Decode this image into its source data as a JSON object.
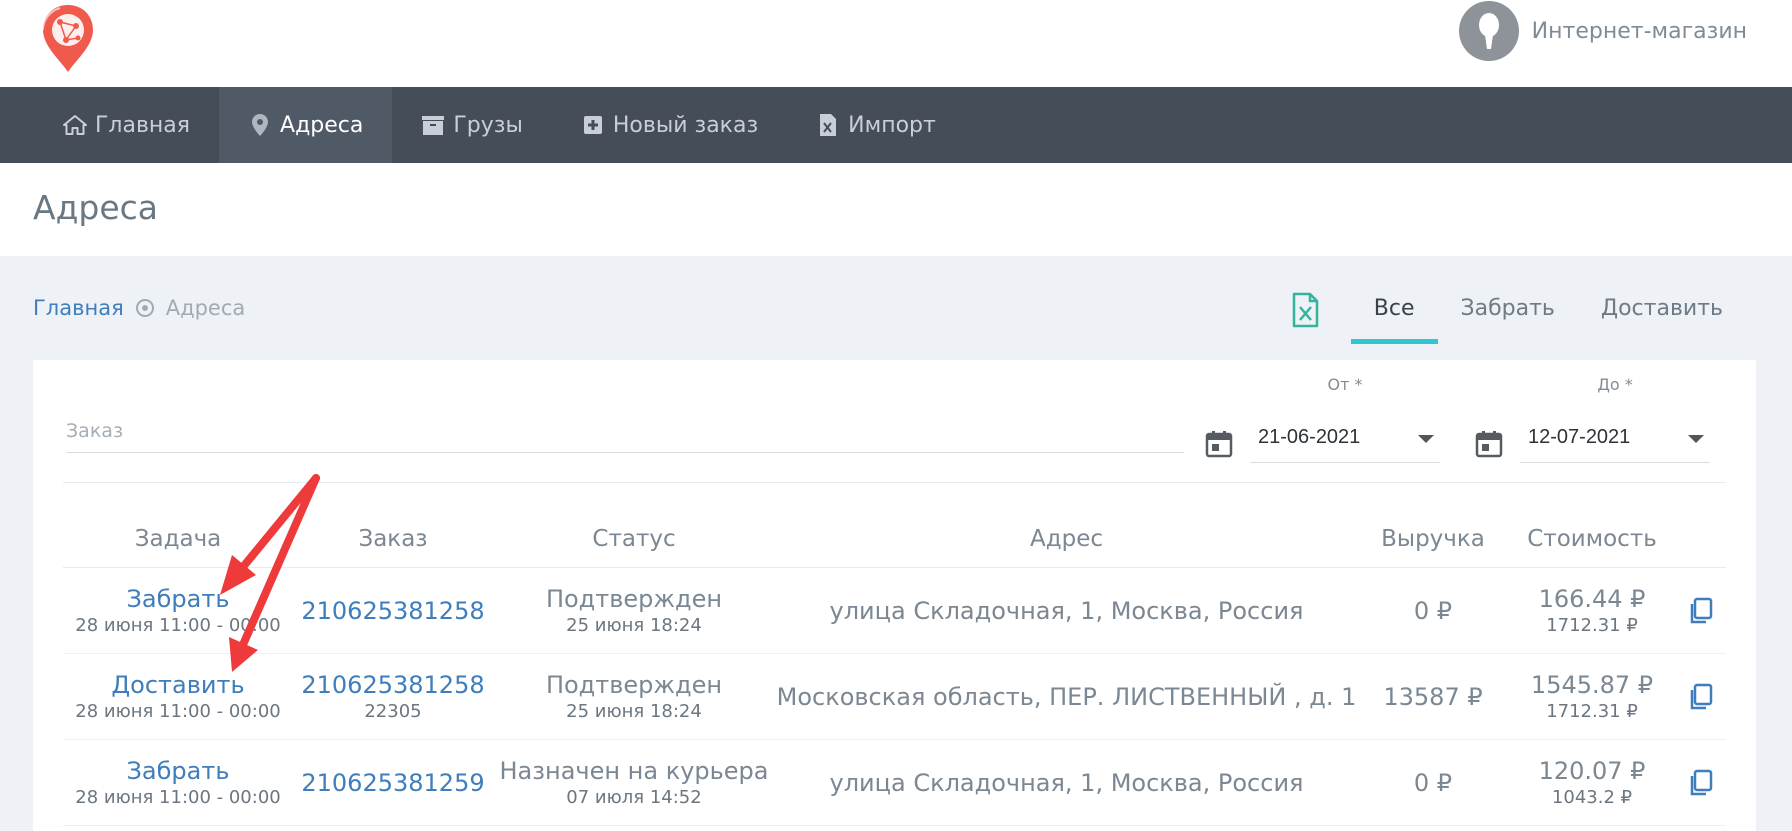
{
  "header": {
    "user_name": "Интернет-магазин"
  },
  "nav": {
    "items": [
      {
        "label": "Главная",
        "icon": "home-icon"
      },
      {
        "label": "Адреса",
        "icon": "map-marker-icon",
        "active": true
      },
      {
        "label": "Грузы",
        "icon": "box-icon"
      },
      {
        "label": "Новый заказ",
        "icon": "plus-square-icon"
      },
      {
        "label": "Импорт",
        "icon": "excel-file-icon"
      }
    ]
  },
  "page": {
    "title": "Адреса"
  },
  "breadcrumb": {
    "home": "Главная",
    "current": "Адреса"
  },
  "tabs": {
    "all": "Все",
    "pickup": "Забрать",
    "deliver": "Доставить",
    "active": "all"
  },
  "filters": {
    "order_placeholder": "Заказ",
    "from_label": "От *",
    "from_value": "21-06-2021",
    "to_label": "До *",
    "to_value": "12-07-2021"
  },
  "table": {
    "headers": {
      "task": "Задача",
      "order": "Заказ",
      "status": "Статус",
      "address": "Адрес",
      "revenue": "Выручка",
      "cost": "Стоимость"
    },
    "rows": [
      {
        "task": "Забрать",
        "task_time": "28 июня 11:00 - 00:00",
        "order": "210625381258",
        "order_sub": "",
        "status": "Подтвержден",
        "status_time": "25 июня 18:24",
        "address": "улица Складочная, 1, Москва, Россия",
        "revenue": "0 ₽",
        "cost": "166.44 ₽",
        "cost_sub": "1712.31 ₽"
      },
      {
        "task": "Доставить",
        "task_time": "28 июня 11:00 - 00:00",
        "order": "210625381258",
        "order_sub": "22305",
        "status": "Подтвержден",
        "status_time": "25 июня 18:24",
        "address": "Московская область, ПЕР. ЛИСТВЕННЫЙ , д. 1",
        "revenue": "13587 ₽",
        "cost": "1545.87 ₽",
        "cost_sub": "1712.31 ₽"
      },
      {
        "task": "Забрать",
        "task_time": "28 июня 11:00 - 00:00",
        "order": "210625381259",
        "order_sub": "",
        "status": "Назначен на курьера",
        "status_time": "07 июля 14:52",
        "address": "улица Складочная, 1, Москва, Россия",
        "revenue": "0 ₽",
        "cost": "120.07 ₽",
        "cost_sub": "1043.2 ₽"
      }
    ]
  },
  "colors": {
    "nav_bg": "#454d59",
    "accent": "#32c5d2",
    "link": "#3f7dbb",
    "annotation_arrow": "#ee3a3a"
  }
}
